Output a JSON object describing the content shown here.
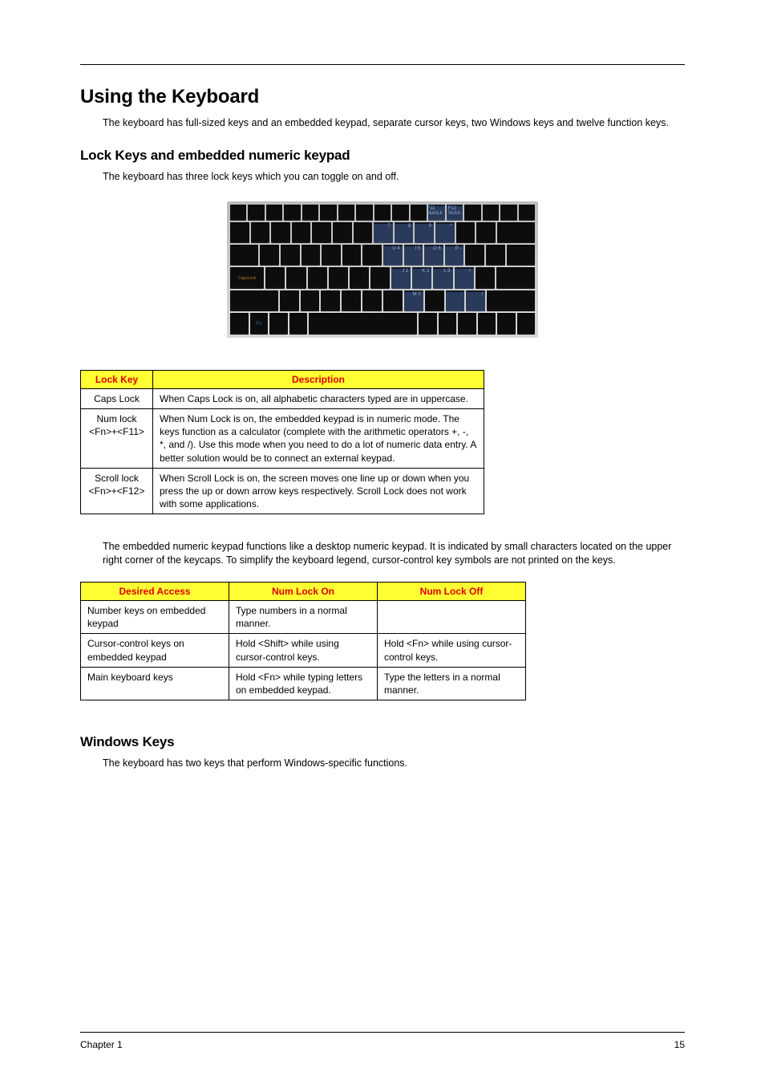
{
  "headings": {
    "h1": "Using the Keyboard",
    "h2a": "Lock Keys and embedded numeric keypad",
    "h2b": "Windows Keys"
  },
  "paragraphs": {
    "intro": "The keyboard has full-sized keys and an embedded keypad, separate cursor keys, two Windows keys and twelve function keys.",
    "lockintro": "The keyboard has three lock keys which you can toggle on and off.",
    "embednote": "The embedded numeric keypad functions like a desktop numeric keypad. It is indicated by small characters located on the upper right corner of the keycaps. To simplify the keyboard legend, cursor-control key symbols are not printed on the keys.",
    "winintro": "The keyboard has two keys that perform Windows-specific functions."
  },
  "table1": {
    "headers": [
      "Lock Key",
      "Description"
    ],
    "rows": [
      {
        "key": "Caps Lock",
        "desc": "When Caps Lock is on, all alphabetic characters typed are in uppercase."
      },
      {
        "key": "Num lock <Fn>+<F11>",
        "desc": "When Num Lock is on, the embedded keypad is in numeric mode. The keys function as a calculator (complete with the arithmetic operators +, -, *, and /). Use this mode when you need to do a lot of numeric data entry. A better solution would be to connect an external keypad."
      },
      {
        "key": "Scroll lock <Fn>+<F12>",
        "desc": "When Scroll Lock is on, the screen moves one line up or down when you press the up or down arrow keys respectively. Scroll Lock does not work with some applications."
      }
    ]
  },
  "table2": {
    "headers": [
      "Desired Access",
      "Num Lock On",
      "Num Lock Off"
    ],
    "rows": [
      {
        "c1": "Number keys on embedded keypad",
        "c2": "Type numbers in a normal manner.",
        "c3": ""
      },
      {
        "c1": "Cursor-control keys on embedded keypad",
        "c2": "Hold <Shift> while using cursor-control keys.",
        "c3": "Hold <Fn> while using cursor-control keys."
      },
      {
        "c1": "Main keyboard keys",
        "c2": "Hold <Fn> while typing letters on embedded keypad.",
        "c3": "Type the letters in a normal manner."
      }
    ]
  },
  "footer": {
    "chapter": "Chapter 1",
    "page": "15"
  }
}
